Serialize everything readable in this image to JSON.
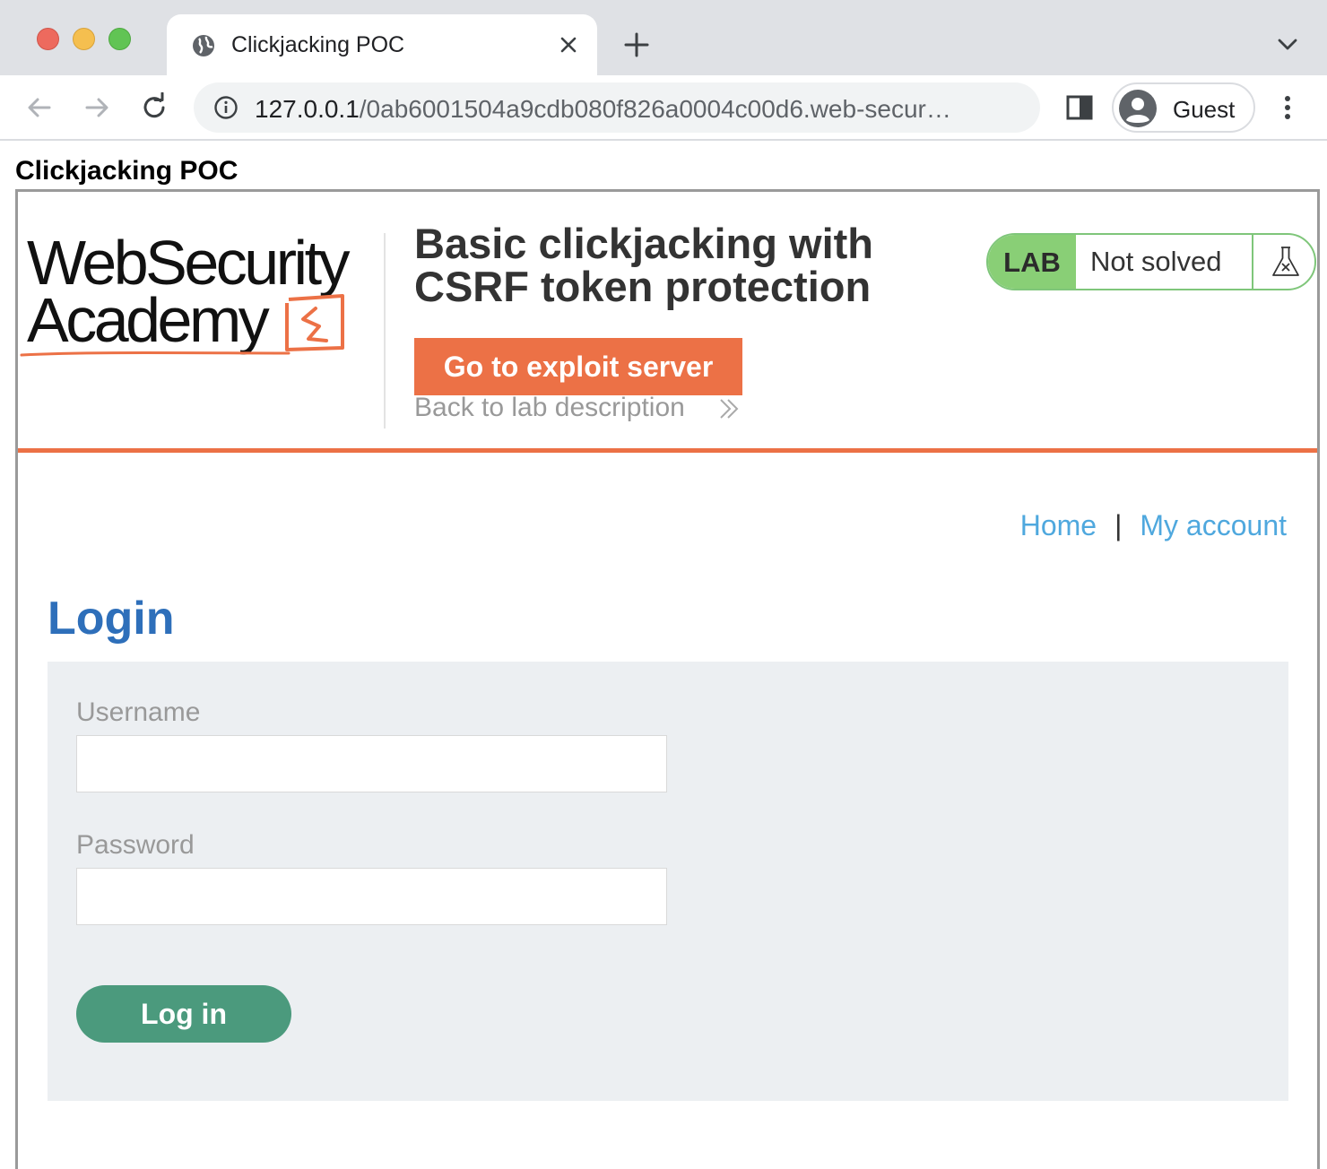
{
  "browser": {
    "tab": {
      "title": "Clickjacking POC"
    },
    "url": {
      "host": "127.0.0.1",
      "path": "/0ab6001504a9cdb080f826a0004c00d6.web-secur…"
    },
    "profile": {
      "label": "Guest"
    }
  },
  "page": {
    "title": "Clickjacking POC"
  },
  "lab": {
    "logo_line1": "WebSecurity",
    "logo_line2": "Academy",
    "title": "Basic clickjacking with CSRF token protection",
    "exploit_button": "Go to exploit server",
    "back_link": "Back to lab description",
    "badge_tag": "LAB",
    "status": "Not solved"
  },
  "nav": {
    "home": "Home",
    "separator": "|",
    "account": "My account"
  },
  "login": {
    "heading": "Login",
    "username_label": "Username",
    "password_label": "Password",
    "submit": "Log in"
  },
  "colors": {
    "accent_orange": "#ec7146",
    "lab_green": "#89cf76",
    "link_blue": "#4fa8de",
    "heading_blue": "#2e6fba",
    "login_button": "#4b9a7d",
    "panel_bg": "#eceff2"
  },
  "icons": [
    "globe-icon",
    "close-icon",
    "plus-icon",
    "chevron-down-icon",
    "back-arrow-icon",
    "forward-arrow-icon",
    "reload-icon",
    "info-icon",
    "sidepanel-icon",
    "avatar-icon",
    "kebab-menu-icon",
    "double-chevron-icon",
    "flask-icon"
  ]
}
